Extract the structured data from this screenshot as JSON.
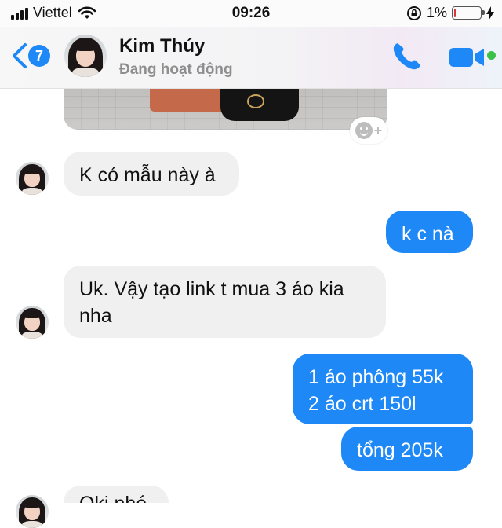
{
  "status_bar": {
    "carrier": "Viettel",
    "time": "09:26",
    "battery_percent": "1%",
    "battery_level": 0.01,
    "icons": [
      "signal-icon",
      "wifi-icon",
      "rotation-lock-icon",
      "battery-icon",
      "charging-icon"
    ]
  },
  "header": {
    "back_count": "7",
    "contact_name": "Kim Thúy",
    "contact_status": "Đang hoạt động",
    "accent_color": "#1e88f6",
    "online_color": "#3bc14a"
  },
  "messages": [
    {
      "sender": "them",
      "text": "K có mẫu này à"
    },
    {
      "sender": "me",
      "text": "k c nà"
    },
    {
      "sender": "them",
      "text": "Uk. Vậy tạo link t mua 3 áo kia\nnha"
    },
    {
      "sender": "me",
      "text": "1 áo phông 55k\n2 áo crt 150l"
    },
    {
      "sender": "me",
      "text": "tổng 205k"
    },
    {
      "sender": "them",
      "text": "Oki nhé"
    }
  ],
  "colors": {
    "incoming_bubble": "#f1f0f0",
    "outgoing_bubble": "#1e88f6"
  }
}
